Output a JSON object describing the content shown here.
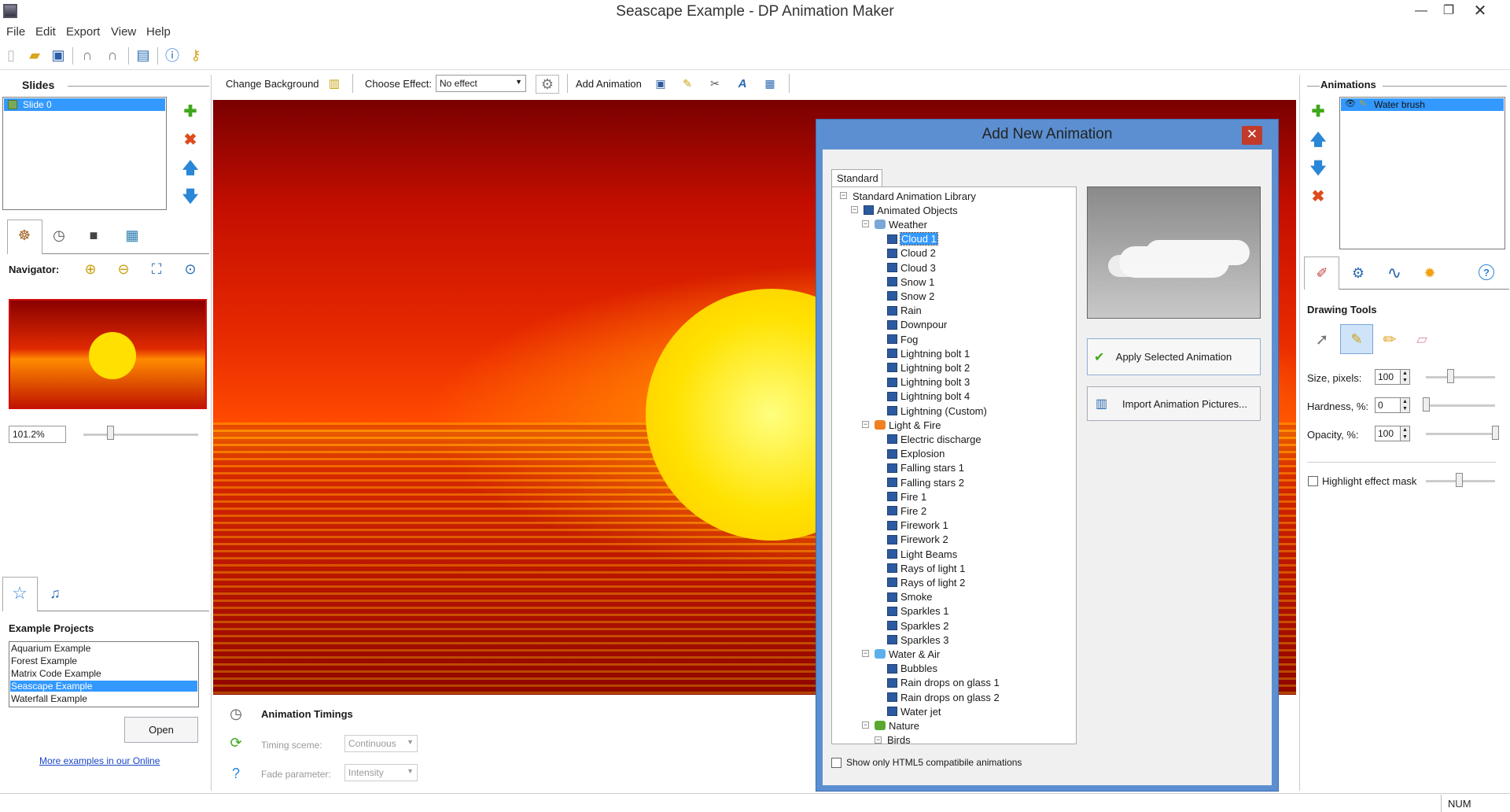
{
  "window": {
    "title": "Seascape Example - DP Animation Maker",
    "minimize": "—",
    "maximize": "❐",
    "close": "✕"
  },
  "menu": [
    "File",
    "Edit",
    "Export",
    "View",
    "Help"
  ],
  "left": {
    "slides_title": "Slides",
    "slides": [
      "Slide 0"
    ],
    "navigator_label": "Navigator:",
    "zoom_value": "101.2%",
    "examples_title": "Example Projects",
    "examples": [
      "Aquarium Example",
      "Forest Example",
      "Matrix Code Example",
      "Seascape Example",
      "Waterfall Example"
    ],
    "open_button": "Open",
    "more_link": "More examples in our Online"
  },
  "effects_bar": {
    "change_background": "Change Background",
    "choose_effect_label": "Choose Effect:",
    "effect_value": "No effect",
    "add_animation": "Add Animation"
  },
  "timings": {
    "title": "Animation Timings",
    "timing_label": "Timing sceme:",
    "timing_value": "Continuous",
    "fade_label": "Fade parameter:",
    "fade_value": "Intensity"
  },
  "dialog": {
    "title": "Add New Animation",
    "close": "✕",
    "tab": "Standard",
    "tree_root": "Standard Animation Library",
    "tree_group": "Animated Objects",
    "folders": [
      {
        "name": "Weather",
        "items": [
          "Cloud 1",
          "Cloud 2",
          "Cloud 3",
          "Snow 1",
          "Snow 2",
          "Rain",
          "Downpour",
          "Fog",
          "Lightning bolt 1",
          "Lightning bolt 2",
          "Lightning bolt 3",
          "Lightning bolt 4",
          "Lightning (Custom)"
        ]
      },
      {
        "name": "Light & Fire",
        "items": [
          "Electric discharge",
          "Explosion",
          "Falling stars 1",
          "Falling stars 2",
          "Fire 1",
          "Fire 2",
          "Firework 1",
          "Firework 2",
          "Light Beams",
          "Rays of light 1",
          "Rays of light 2",
          "Smoke",
          "Sparkles 1",
          "Sparkles 2",
          "Sparkles 3"
        ]
      },
      {
        "name": "Water & Air",
        "items": [
          "Bubbles",
          "Rain drops on glass 1",
          "Rain drops on glass 2",
          "Water jet"
        ]
      },
      {
        "name": "Nature",
        "items": []
      }
    ],
    "subfolder": "Birds",
    "selected": "Cloud 1",
    "apply_button": "Apply Selected Animation",
    "import_button": "Import Animation Pictures...",
    "html5_checkbox": "Show only HTML5 compatibile animations"
  },
  "right": {
    "animations_title": "Animations",
    "animations": [
      "Water brush"
    ],
    "drawing_tools_title": "Drawing Tools",
    "size_label": "Size, pixels:",
    "size_value": "100",
    "size_level": 0.35,
    "hardness_label": "Hardness, %:",
    "hardness_value": "0",
    "hardness_level": 0.0,
    "opacity_label": "Opacity, %:",
    "opacity_value": "100",
    "opacity_level": 1.0,
    "highlight_label": "Highlight effect mask"
  },
  "status": {
    "num": "NUM"
  },
  "colors": {
    "selection": "#3399ff",
    "dialog_frame": "#5b8fd1",
    "close_red": "#c23a2a"
  }
}
